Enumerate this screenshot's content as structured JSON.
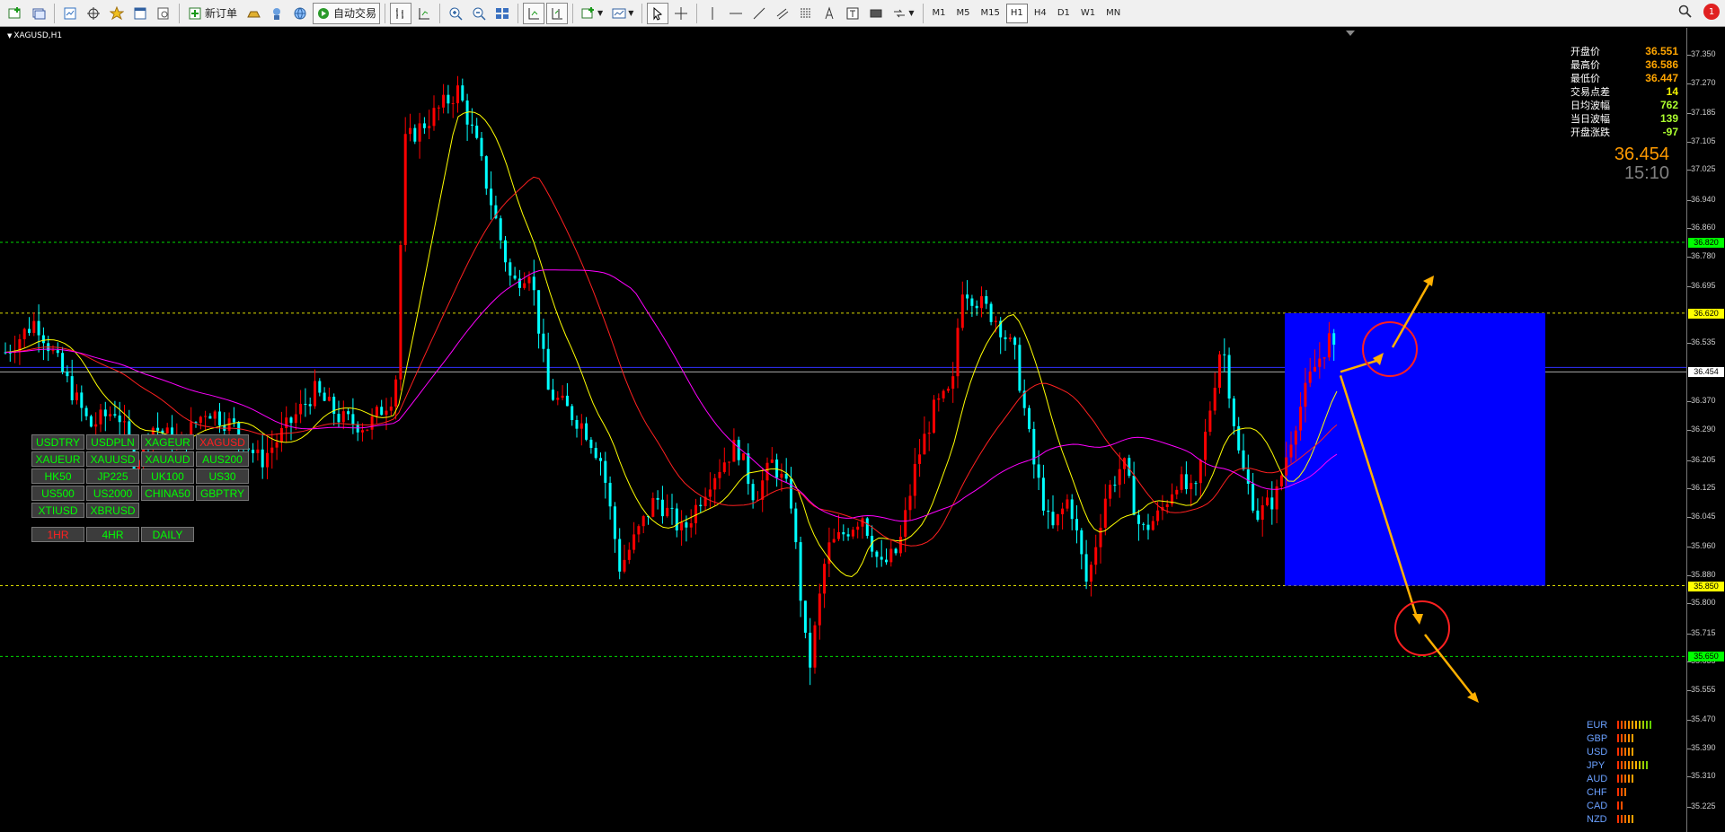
{
  "toolbar": {
    "new_order_label": "新订单",
    "auto_trade_label": "自动交易",
    "timeframes": [
      "M1",
      "M5",
      "M15",
      "H1",
      "H4",
      "D1",
      "W1",
      "MN"
    ],
    "active_timeframe": "H1",
    "notification_count": "1"
  },
  "chart": {
    "symbol_title": "XAGUSD,H1",
    "background_color": "#000000",
    "bull_color": "#ff0000",
    "bear_color": "#00ffff",
    "ma_colors": [
      "#ffff00",
      "#ff2020",
      "#ff00ff"
    ],
    "level_lines": [
      {
        "price": 36.82,
        "color": "#00ff00"
      },
      {
        "price": 36.62,
        "color": "#ffff00"
      },
      {
        "price": 35.85,
        "color": "#ffff00"
      },
      {
        "price": 35.65,
        "color": "#00ff00"
      }
    ],
    "current_price_line": 36.454,
    "annotation_box_color": "#0000ff"
  },
  "symbol_panel": {
    "symbols": [
      "USDTRY",
      "USDPLN",
      "XAGEUR",
      "XAGUSD",
      "XAUEUR",
      "XAUUSD",
      "XAUAUD",
      "AUS200",
      "HK50",
      "JP225",
      "UK100",
      "US30",
      "US500",
      "US2000",
      "CHINA50",
      "GBPTRY",
      "XTIUSD",
      "XBRUSD"
    ],
    "active_symbol": "XAGUSD",
    "timeframe_buttons": [
      "1HR",
      "4HR",
      "DAILY"
    ],
    "active_timeframe_button": "1HR"
  },
  "info_panel": {
    "rows": [
      {
        "label": "开盘价",
        "value": "36.551",
        "color": "orange"
      },
      {
        "label": "最高价",
        "value": "36.586",
        "color": "orange"
      },
      {
        "label": "最低价",
        "value": "36.447",
        "color": "orange"
      },
      {
        "label": "交易点差",
        "value": "14",
        "color": "yellow"
      },
      {
        "label": "日均波幅",
        "value": "762",
        "color": "lime"
      },
      {
        "label": "当日波幅",
        "value": "139",
        "color": "lime"
      },
      {
        "label": "开盘涨跌",
        "value": "-97",
        "color": "lime"
      }
    ],
    "current_price": "36.454",
    "time": "15:10"
  },
  "currency_strength": [
    {
      "name": "EUR",
      "level": 10
    },
    {
      "name": "GBP",
      "level": 5
    },
    {
      "name": "USD",
      "level": 5
    },
    {
      "name": "JPY",
      "level": 9
    },
    {
      "name": "AUD",
      "level": 5
    },
    {
      "name": "CHF",
      "level": 3
    },
    {
      "name": "CAD",
      "level": 2
    },
    {
      "name": "NZD",
      "level": 5
    }
  ],
  "price_axis": {
    "ticks": [
      "37.350",
      "37.270",
      "37.185",
      "37.105",
      "37.025",
      "36.940",
      "36.860",
      "36.780",
      "36.695",
      "36.535",
      "36.370",
      "36.290",
      "36.205",
      "36.125",
      "36.045",
      "35.960",
      "35.880",
      "35.800",
      "35.715",
      "35.635",
      "35.555",
      "35.470",
      "35.390",
      "35.310",
      "35.225"
    ],
    "tags": [
      {
        "text": "36.820",
        "bg": "#00ff00",
        "fg": "#000000"
      },
      {
        "text": "36.620",
        "bg": "#ffff00",
        "fg": "#000000"
      },
      {
        "text": "36.454",
        "bg": "#ffffff",
        "fg": "#000000"
      },
      {
        "text": "35.850",
        "bg": "#ffff00",
        "fg": "#000000"
      },
      {
        "text": "35.650",
        "bg": "#00ff00",
        "fg": "#000000"
      }
    ]
  }
}
